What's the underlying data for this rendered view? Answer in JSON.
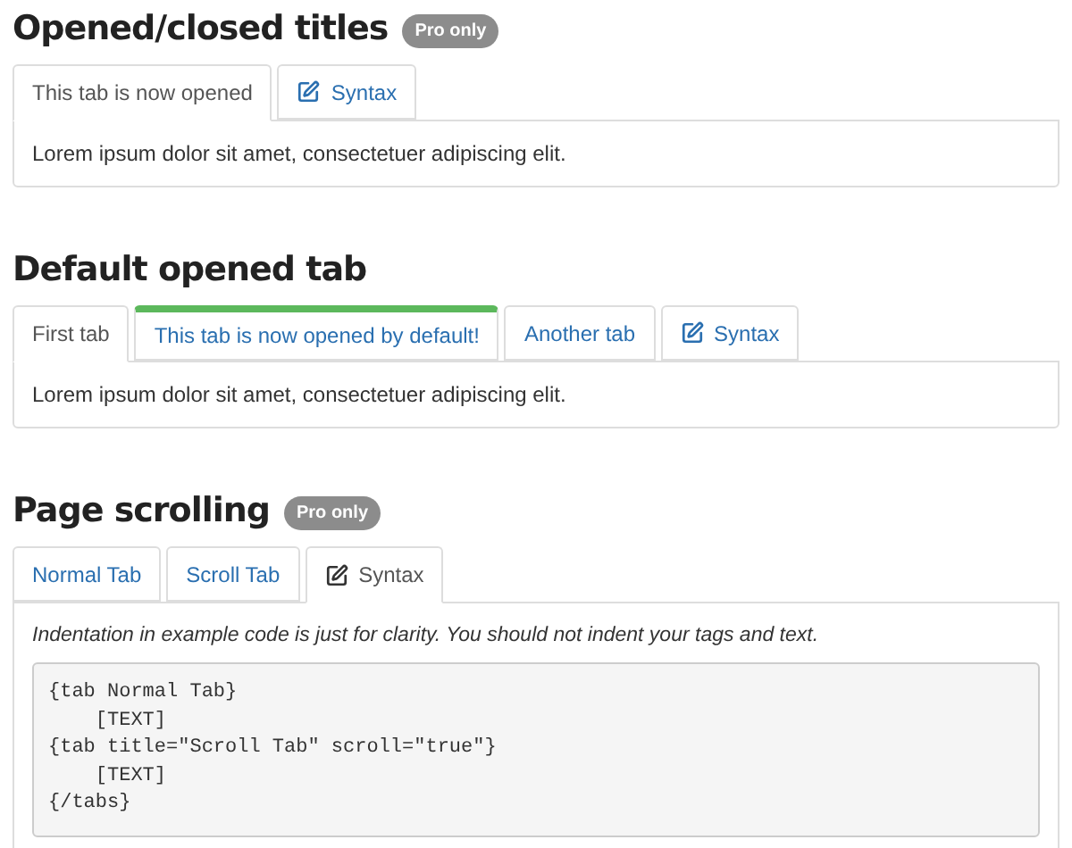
{
  "sections": [
    {
      "title": "Opened/closed titles",
      "badge": "Pro only",
      "tabs": [
        {
          "kind": "plain",
          "label": "This tab is now opened",
          "selected": true,
          "highlighted": false
        },
        {
          "kind": "syntax",
          "label": "Syntax",
          "selected": false,
          "highlighted": false
        }
      ],
      "content": {
        "kind": "text",
        "text": "Lorem ipsum dolor sit amet, consectetuer adipiscing elit."
      }
    },
    {
      "title": "Default opened tab",
      "tabs": [
        {
          "kind": "plain",
          "label": "First tab",
          "selected": true,
          "highlighted": false
        },
        {
          "kind": "plain",
          "label": "This tab is now opened by default!",
          "selected": false,
          "highlighted": true
        },
        {
          "kind": "plain",
          "label": "Another tab",
          "selected": false,
          "highlighted": false
        },
        {
          "kind": "syntax",
          "label": "Syntax",
          "selected": false,
          "highlighted": false
        }
      ],
      "content": {
        "kind": "text",
        "text": "Lorem ipsum dolor sit amet, consectetuer adipiscing elit."
      }
    },
    {
      "title": "Page scrolling",
      "badge": "Pro only",
      "tabs": [
        {
          "kind": "plain",
          "label": "Normal Tab",
          "selected": false,
          "highlighted": false
        },
        {
          "kind": "plain",
          "label": "Scroll Tab",
          "selected": false,
          "highlighted": false
        },
        {
          "kind": "syntax",
          "label": "Syntax",
          "selected": true,
          "highlighted": false
        }
      ],
      "content": {
        "kind": "syntax",
        "note": "Indentation in example code is just for clarity. You should not indent your tags and text.",
        "code_lines": [
          "{tab Normal Tab}",
          "    [TEXT]",
          "{tab title=\"Scroll Tab\" scroll=\"true\"}",
          "    [TEXT]",
          "{/tabs}"
        ]
      }
    }
  ]
}
